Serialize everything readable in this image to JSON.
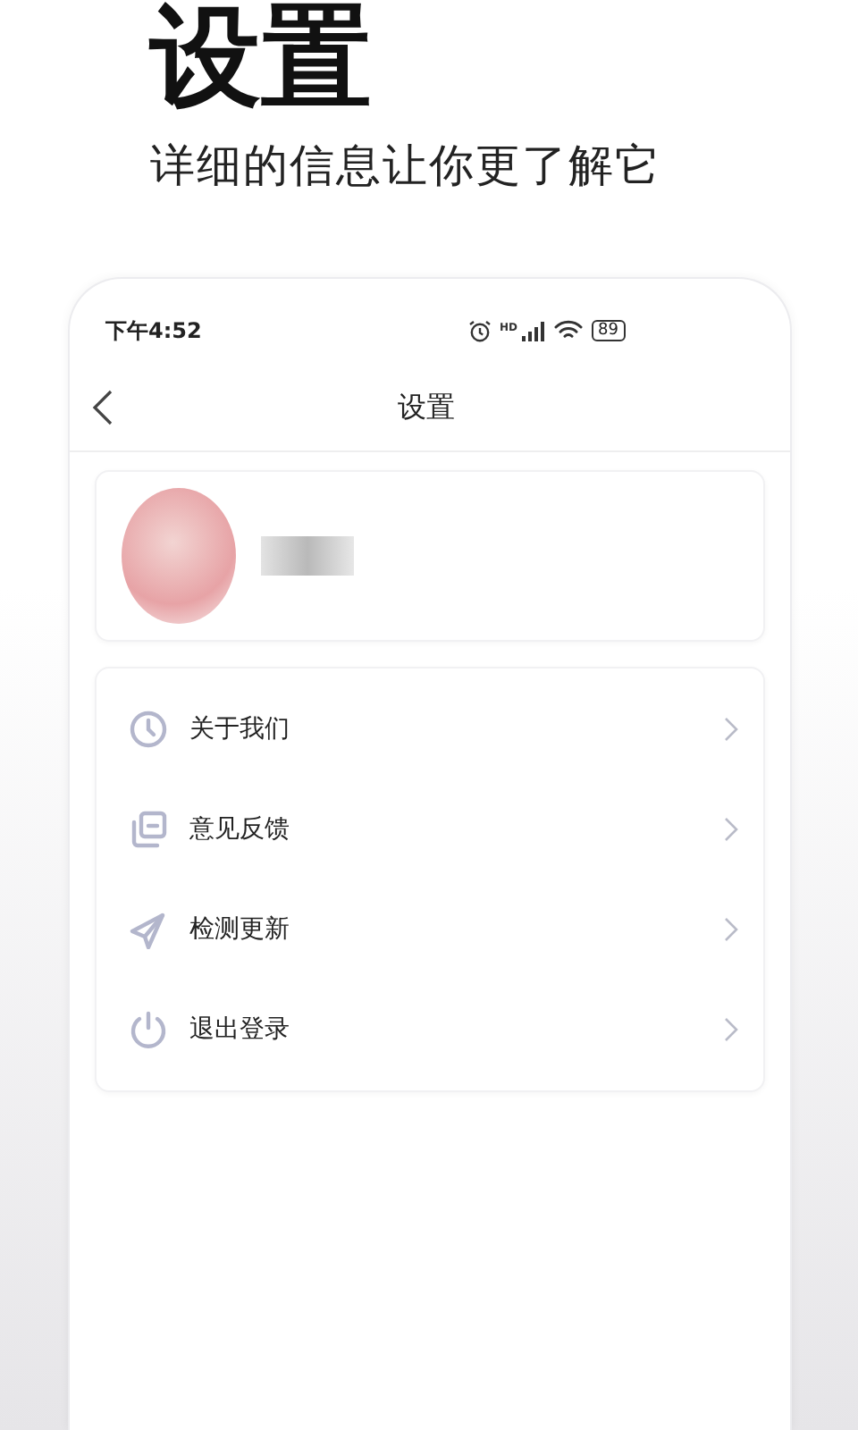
{
  "promo": {
    "title": "设置",
    "subtitle": "详细的信息让你更了解它"
  },
  "status_bar": {
    "time": "下午4:52",
    "network_label": "HD",
    "battery": "89"
  },
  "nav": {
    "title": "设置"
  },
  "menu": [
    {
      "label": "关于我们"
    },
    {
      "label": "意见反馈"
    },
    {
      "label": "检测更新"
    },
    {
      "label": "退出登录"
    }
  ]
}
